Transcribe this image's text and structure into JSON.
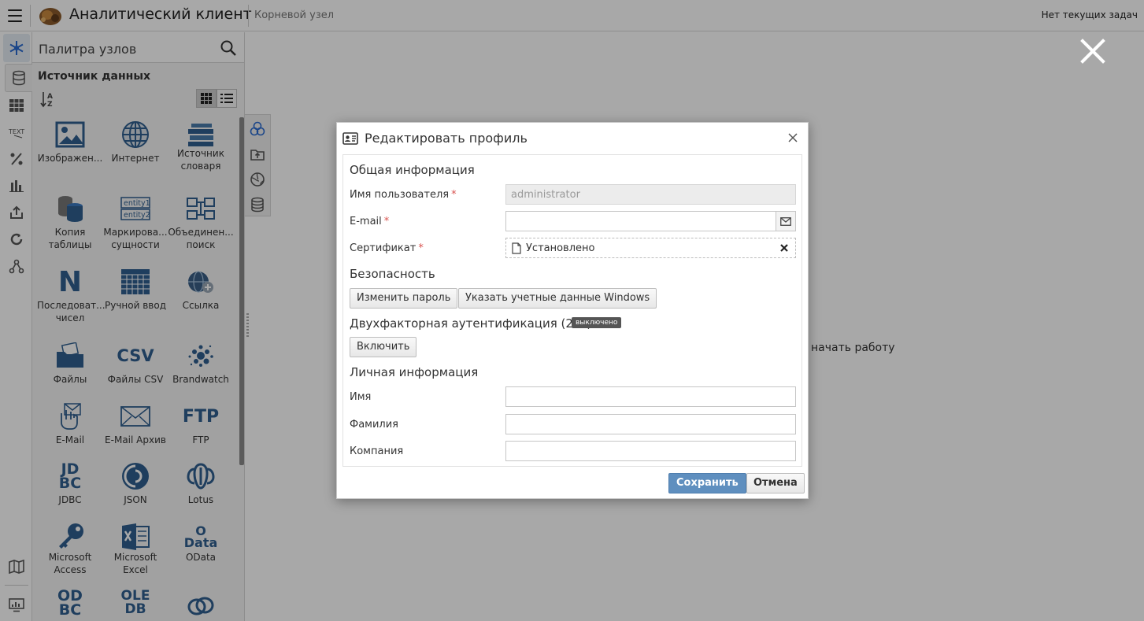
{
  "header": {
    "app_title": "Аналитический клиент",
    "breadcrumb": "Корневой узел",
    "tasks_status": "Нет текущих задач"
  },
  "rail": {
    "icons": [
      "nodes-icon",
      "database-icon",
      "table-icon",
      "text-icon",
      "percent-icon",
      "chart-icon",
      "export-icon",
      "cycle-icon",
      "model-icon",
      "map-icon",
      "monitor-icon"
    ]
  },
  "palette": {
    "search_placeholder": "Палитра узлов",
    "category": "Источник данных",
    "tiles": [
      {
        "label": "Изображен...",
        "icon": "image-icon"
      },
      {
        "label": "Интернет",
        "icon": "globe-icon"
      },
      {
        "label": "Источник словаря",
        "icon": "books-icon"
      },
      {
        "label": "Копия таблицы",
        "icon": "db-copy-icon"
      },
      {
        "label": "Маркирова... сущности",
        "icon": "entity-icon",
        "icon_text": [
          "entity1",
          "entity2"
        ]
      },
      {
        "label": "Объединен... поиск",
        "icon": "join-icon"
      },
      {
        "label": "Последоват... чисел",
        "icon": "sequence-icon",
        "icon_text": "N"
      },
      {
        "label": "Ручной ввод",
        "icon": "manual-grid-icon"
      },
      {
        "label": "Ссылка",
        "icon": "link-icon"
      },
      {
        "label": "Файлы",
        "icon": "folder-icon"
      },
      {
        "label": "Файлы CSV",
        "icon": "csv-icon",
        "icon_text": "CSV"
      },
      {
        "label": "Brandwatch",
        "icon": "brandwatch-icon"
      },
      {
        "label": "E-Mail",
        "icon": "mail-hand-icon"
      },
      {
        "label": "E-Mail Архив",
        "icon": "envelope-icon"
      },
      {
        "label": "FTP",
        "icon": "ftp-icon",
        "icon_text": "FTP"
      },
      {
        "label": "JDBC",
        "icon": "jdbc-icon",
        "icon_text": [
          "JD",
          "BC"
        ]
      },
      {
        "label": "JSON",
        "icon": "json-icon"
      },
      {
        "label": "Lotus",
        "icon": "lotus-icon"
      },
      {
        "label": "Microsoft Access",
        "icon": "access-key-icon"
      },
      {
        "label": "Microsoft Excel",
        "icon": "excel-icon"
      },
      {
        "label": "OData",
        "icon": "odata-icon",
        "icon_text": [
          "O",
          "Data"
        ]
      },
      {
        "label": "",
        "icon": "odbc-icon",
        "icon_text": [
          "OD",
          "BC"
        ]
      },
      {
        "label": "",
        "icon": "oledb-icon",
        "icon_text": [
          "OLE",
          "DB"
        ]
      },
      {
        "label": "",
        "icon": "misc-source-icon"
      }
    ]
  },
  "workspace": {
    "hint": "начать работу"
  },
  "dialog": {
    "title": "Редактировать профиль",
    "general_section": "Общая информация",
    "username_label": "Имя пользователя",
    "username_value": "administrator",
    "email_label": "E-mail",
    "email_value": "",
    "certificate_label": "Сертификат",
    "certificate_value": "Установлено",
    "security_section": "Безопасность",
    "change_password": "Изменить пароль",
    "windows_credentials": "Указать учетные данные Windows",
    "twofa_section": "Двухфакторная аутентификация (2FA)",
    "twofa_status": "выключено",
    "enable_button": "Включить",
    "personal_section": "Личная информация",
    "first_name_label": "Имя",
    "last_name_label": "Фамилия",
    "company_label": "Компания",
    "save_button": "Сохранить",
    "cancel_button": "Отмена"
  },
  "colors": {
    "icon_blue": "#2f5f8f",
    "required": "#d9534f",
    "save_button": "#5f8fbf"
  }
}
